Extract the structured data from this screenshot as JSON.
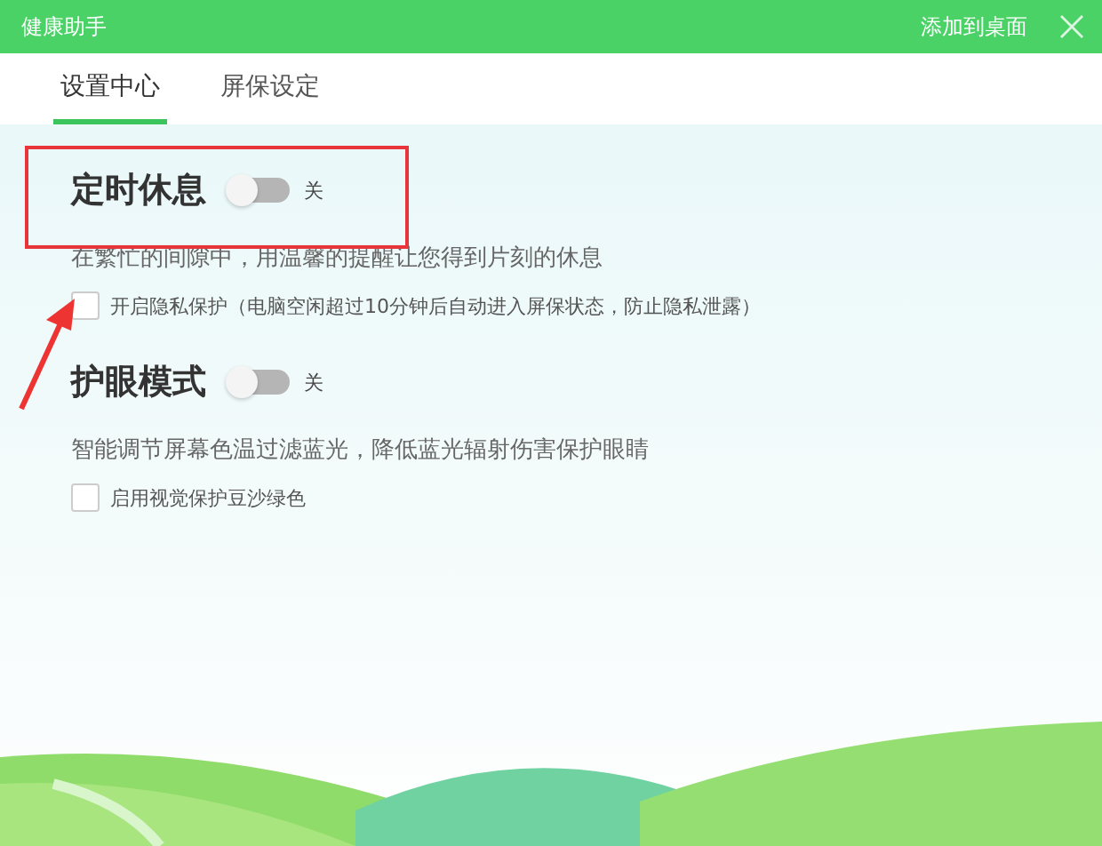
{
  "window": {
    "title": "健康助手",
    "action": "添加到桌面"
  },
  "tabs": [
    {
      "label": "设置中心",
      "selected": true
    },
    {
      "label": "屏保设定",
      "selected": false
    }
  ],
  "sections": [
    {
      "title": "定时休息",
      "toggle_on": false,
      "toggle_label": "关",
      "description": "在繁忙的间隙中，用温馨的提醒让您得到片刻的休息",
      "checkbox": {
        "label": "开启隐私保护（电脑空闲超过10分钟后自动进入屏保状态，防止隐私泄露）",
        "checked": false
      }
    },
    {
      "title": "护眼模式",
      "toggle_on": false,
      "toggle_label": "关",
      "description": "智能调节屏幕色温过滤蓝光，降低蓝光辐射伤害保护眼睛",
      "checkbox": {
        "label": "启用视觉保护豆沙绿色",
        "checked": false
      }
    }
  ]
}
